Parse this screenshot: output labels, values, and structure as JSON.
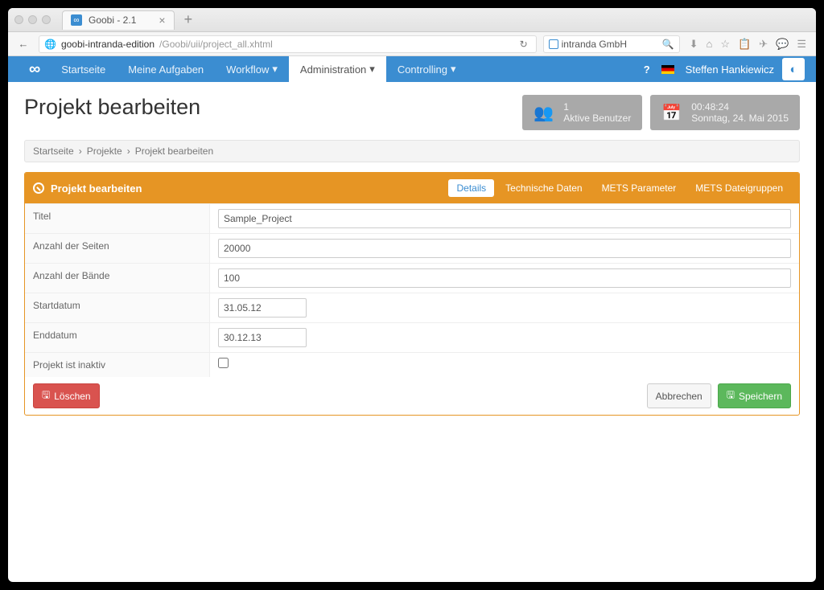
{
  "browser": {
    "tab_title": "Goobi - 2.1",
    "url_host": "goobi-intranda-edition",
    "url_path": "/Goobi/uii/project_all.xhtml",
    "search_placeholder": "intranda GmbH"
  },
  "nav": {
    "items": [
      "Startseite",
      "Meine Aufgaben",
      "Workflow",
      "Administration",
      "Controlling"
    ],
    "active_index": 3,
    "user": "Steffen Hankiewicz"
  },
  "header": {
    "page_title": "Projekt bearbeiten",
    "users_box": {
      "count": "1",
      "label": "Aktive Benutzer"
    },
    "time_box": {
      "time": "00:48:24",
      "date": "Sonntag, 24. Mai 2015"
    }
  },
  "breadcrumb": [
    "Startseite",
    "Projekte",
    "Projekt bearbeiten"
  ],
  "panel": {
    "title": "Projekt bearbeiten",
    "tabs": [
      "Details",
      "Technische Daten",
      "METS Parameter",
      "METS Dateigruppen"
    ],
    "active_tab": 0
  },
  "form": {
    "titel": {
      "label": "Titel",
      "value": "Sample_Project"
    },
    "seiten": {
      "label": "Anzahl der Seiten",
      "value": "20000"
    },
    "baende": {
      "label": "Anzahl der Bände",
      "value": "100"
    },
    "start": {
      "label": "Startdatum",
      "value": "31.05.12"
    },
    "end": {
      "label": "Enddatum",
      "value": "30.12.13"
    },
    "inaktiv": {
      "label": "Projekt ist inaktiv",
      "checked": false
    }
  },
  "buttons": {
    "delete": "Löschen",
    "cancel": "Abbrechen",
    "save": "Speichern"
  }
}
